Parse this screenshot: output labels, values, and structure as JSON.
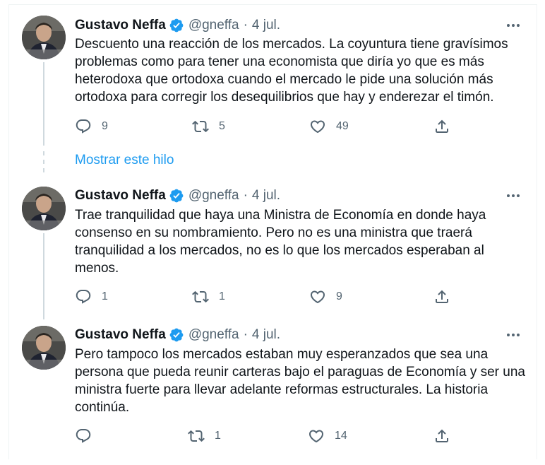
{
  "colors": {
    "accent": "#1d9bf0",
    "text": "#0f1419",
    "muted": "#536471",
    "thread_line": "#cfd9de"
  },
  "show_thread_label": "Mostrar este hilo",
  "tweets": [
    {
      "author_name": "Gustavo Neffa",
      "handle": "@gneffa",
      "separator": "·",
      "date": "4 jul.",
      "lines": [
        "Descuento una reacción de los mercados. La coyuntura tiene gravísimos",
        "problemas como para tener una economista que diría yo que es más",
        "heterodoxa que ortodoxa cuando el mercado le pide una solución más",
        "ortodoxa para corregir los desequilibrios que hay y enderezar el timón."
      ],
      "replies": "9",
      "retweets": "5",
      "likes": "49"
    },
    {
      "author_name": "Gustavo Neffa",
      "handle": "@gneffa",
      "separator": "·",
      "date": "4 jul.",
      "lines": [
        "Trae tranquilidad que haya una Ministra de Economía en donde haya",
        "consenso en su nombramiento. Pero no es una ministra que traerá",
        "tranquilidad a los mercados, no es lo que los mercados esperaban al",
        "menos."
      ],
      "replies": "1",
      "retweets": "1",
      "likes": "9"
    },
    {
      "author_name": "Gustavo Neffa",
      "handle": "@gneffa",
      "separator": "·",
      "date": "4 jul.",
      "lines": [
        "Pero tampoco los mercados estaban muy esperanzados que sea una",
        "persona que pueda reunir carteras bajo el paraguas de Economía y ser una",
        "ministra fuerte para llevar adelante reformas estructurales. La historia",
        "continúa."
      ],
      "replies": "",
      "retweets": "1",
      "likes": "14"
    }
  ]
}
